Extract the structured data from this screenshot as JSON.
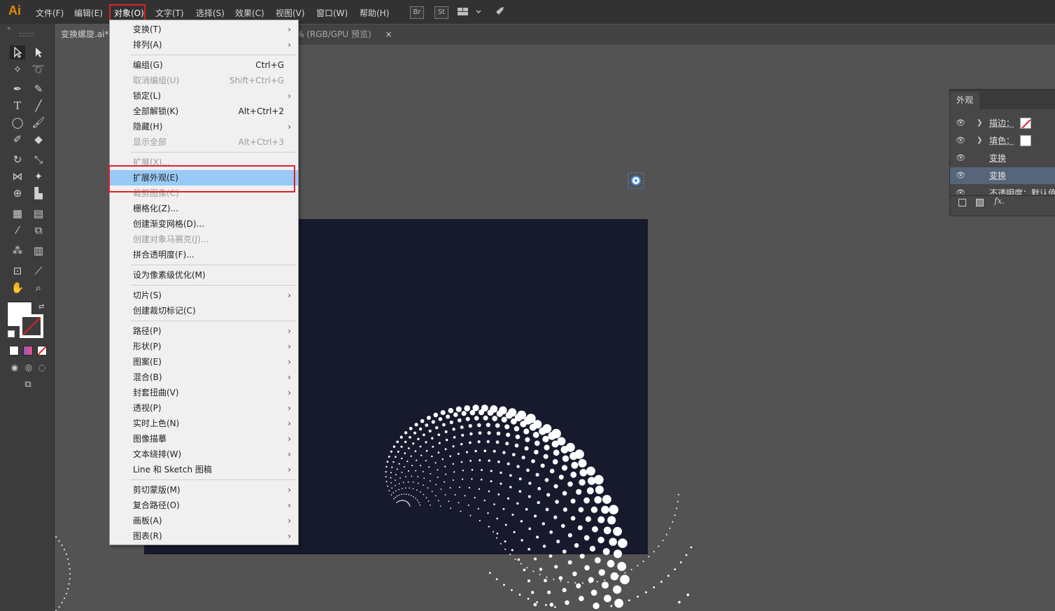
{
  "app": {
    "logo": "Ai"
  },
  "menubar": {
    "items": [
      "文件(F)",
      "编辑(E)",
      "对象(O)",
      "文字(T)",
      "选择(S)",
      "效果(C)",
      "视图(V)",
      "窗口(W)",
      "帮助(H)"
    ],
    "bridge_btn": "Br",
    "stock_btn": "St"
  },
  "tabs": {
    "doc_tab_name": "变换螺旋.ai*",
    "doc_tab_suffix": "% (RGB/GPU 预览)",
    "close_glyph": "×"
  },
  "object_menu": {
    "items": [
      {
        "label": "变换(T)",
        "shortcut": "",
        "submenu": true,
        "disabled": false
      },
      {
        "label": "排列(A)",
        "shortcut": "",
        "submenu": true,
        "disabled": false
      },
      {
        "label": "编组(G)",
        "shortcut": "Ctrl+G",
        "submenu": false,
        "disabled": false
      },
      {
        "label": "取消编组(U)",
        "shortcut": "Shift+Ctrl+G",
        "submenu": false,
        "disabled": true
      },
      {
        "label": "锁定(L)",
        "shortcut": "",
        "submenu": true,
        "disabled": false
      },
      {
        "label": "全部解锁(K)",
        "shortcut": "Alt+Ctrl+2",
        "submenu": false,
        "disabled": false
      },
      {
        "label": "隐藏(H)",
        "shortcut": "",
        "submenu": true,
        "disabled": false
      },
      {
        "label": "显示全部",
        "shortcut": "Alt+Ctrl+3",
        "submenu": false,
        "disabled": true
      },
      {
        "label": "扩展(X)...",
        "shortcut": "",
        "submenu": false,
        "disabled": true
      },
      {
        "label": "扩展外观(E)",
        "shortcut": "",
        "submenu": false,
        "disabled": false,
        "highlighted": true
      },
      {
        "label": "裁剪图像(C)",
        "shortcut": "",
        "submenu": false,
        "disabled": true
      },
      {
        "label": "栅格化(Z)...",
        "shortcut": "",
        "submenu": false,
        "disabled": false
      },
      {
        "label": "创建渐变网格(D)...",
        "shortcut": "",
        "submenu": false,
        "disabled": false
      },
      {
        "label": "创建对象马赛克(J)...",
        "shortcut": "",
        "submenu": false,
        "disabled": true
      },
      {
        "label": "拼合透明度(F)...",
        "shortcut": "",
        "submenu": false,
        "disabled": false
      },
      {
        "label": "设为像素级优化(M)",
        "shortcut": "",
        "submenu": false,
        "disabled": false
      },
      {
        "label": "切片(S)",
        "shortcut": "",
        "submenu": true,
        "disabled": false
      },
      {
        "label": "创建裁切标记(C)",
        "shortcut": "",
        "submenu": false,
        "disabled": false
      },
      {
        "label": "路径(P)",
        "shortcut": "",
        "submenu": true,
        "disabled": false
      },
      {
        "label": "形状(P)",
        "shortcut": "",
        "submenu": true,
        "disabled": false
      },
      {
        "label": "图案(E)",
        "shortcut": "",
        "submenu": true,
        "disabled": false
      },
      {
        "label": "混合(B)",
        "shortcut": "",
        "submenu": true,
        "disabled": false
      },
      {
        "label": "封套扭曲(V)",
        "shortcut": "",
        "submenu": true,
        "disabled": false
      },
      {
        "label": "透视(P)",
        "shortcut": "",
        "submenu": true,
        "disabled": false
      },
      {
        "label": "实时上色(N)",
        "shortcut": "",
        "submenu": true,
        "disabled": false
      },
      {
        "label": "图像描摹",
        "shortcut": "",
        "submenu": true,
        "disabled": false
      },
      {
        "label": "文本绕排(W)",
        "shortcut": "",
        "submenu": true,
        "disabled": false
      },
      {
        "label": "Line 和 Sketch 图稿",
        "shortcut": "",
        "submenu": true,
        "disabled": false
      },
      {
        "label": "剪切蒙版(M)",
        "shortcut": "",
        "submenu": true,
        "disabled": false
      },
      {
        "label": "复合路径(O)",
        "shortcut": "",
        "submenu": true,
        "disabled": false
      },
      {
        "label": "画板(A)",
        "shortcut": "",
        "submenu": true,
        "disabled": false
      },
      {
        "label": "图表(R)",
        "shortcut": "",
        "submenu": true,
        "disabled": false
      }
    ]
  },
  "appearance_panel": {
    "title": "外观",
    "rows": [
      {
        "label": "描边：",
        "has_chevron": true,
        "swatch": "stroke-none"
      },
      {
        "label": "填色：",
        "has_chevron": true,
        "swatch": "fill-white"
      },
      {
        "label": "变换",
        "has_chevron": false,
        "swatch": ""
      },
      {
        "label": "变换",
        "has_chevron": false,
        "swatch": "",
        "selected": true
      },
      {
        "label": "不透明度：默认值",
        "has_chevron": false,
        "swatch": ""
      }
    ],
    "footer_fx": "fx."
  },
  "colors": {
    "artboard": "#171a2c",
    "menu_highlight": "#99c9f5",
    "annotation_red": "#e0202a",
    "logo": "#ff9a00"
  }
}
